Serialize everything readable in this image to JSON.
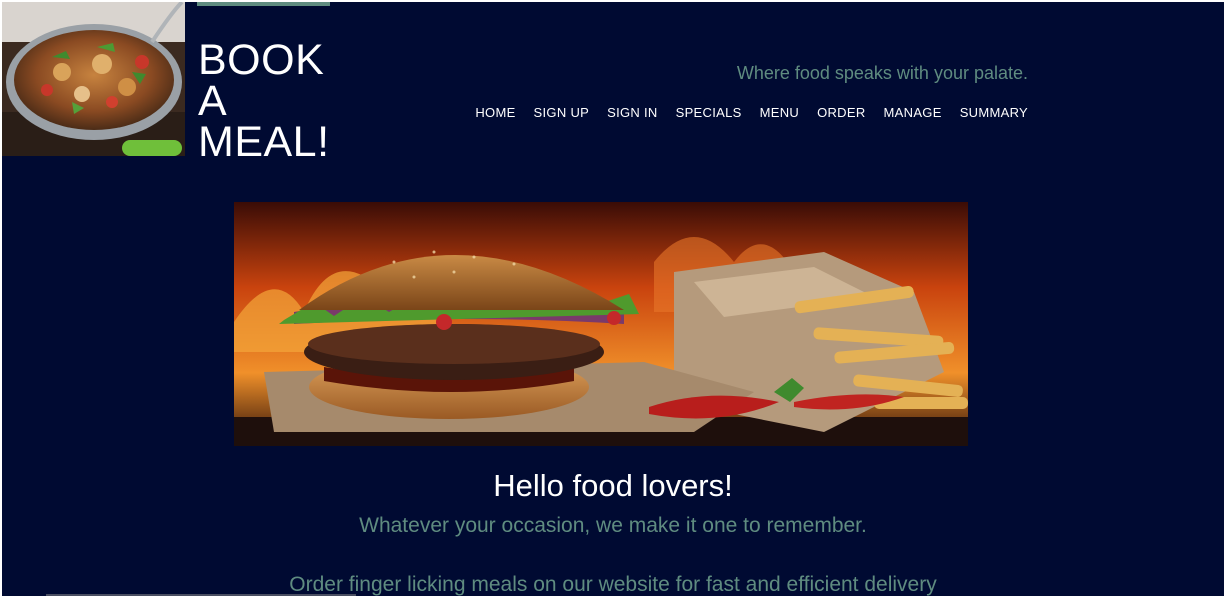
{
  "header": {
    "brand_lines": [
      "BOOK",
      "A",
      "MEAL!"
    ],
    "tagline": "Where food speaks with your palate.",
    "nav": [
      "HOME",
      "SIGN UP",
      "SIGN IN",
      "SPECIALS",
      "MENU",
      "ORDER",
      "MANAGE",
      "SUMMARY"
    ]
  },
  "main": {
    "heading": "Hello food lovers!",
    "subheading": "Whatever your occasion, we make it one to remember.",
    "order_text": "Order finger licking meals on our website for fast and efficient delivery"
  },
  "colors": {
    "background": "#000a32",
    "accent": "#5f8c80",
    "text": "#ffffff"
  }
}
